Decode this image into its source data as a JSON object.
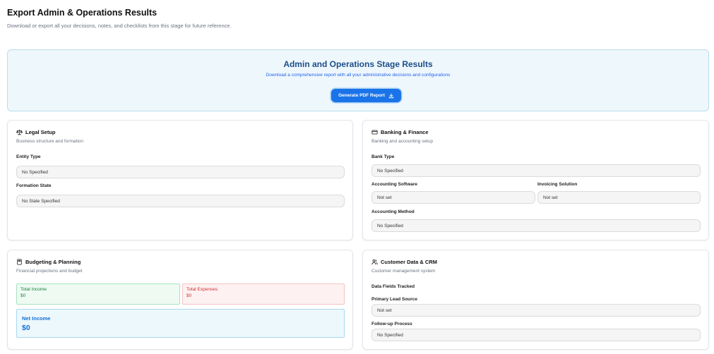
{
  "header": {
    "title": "Export Admin & Operations Results",
    "subtitle": "Download or export all your decisions, notes, and checklists from this stage for future reference."
  },
  "hero": {
    "title": "Admin and Operations Stage Results",
    "description": "Download a comprehensive report with all your administrative decisions and configurations",
    "button_label": "Generate PDF Report",
    "button_icon": "download-icon"
  },
  "legal": {
    "icon": "scale-icon",
    "title": "Legal Setup",
    "subtitle": "Business structure and formation",
    "entity_type_label": "Entity Type",
    "entity_type_value": "No Specified",
    "formation_state_label": "Formation State",
    "formation_state_value": "No State Specified"
  },
  "banking": {
    "icon": "credit-card-icon",
    "title": "Banking & Finance",
    "subtitle": "Banking and accounting setup",
    "bank_type_label": "Bank Type",
    "bank_type_value": "No Specified",
    "accounting_software_label": "Accounting Software",
    "accounting_software_value": "Not set",
    "invoicing_label": "Invoicing Solution",
    "invoicing_value": "Not set",
    "accounting_method_label": "Accounting Method",
    "accounting_method_value": "No Specified"
  },
  "budgeting": {
    "icon": "calculator-icon",
    "title": "Budgeting & Planning",
    "subtitle": "Financial projections and budget",
    "income_label": "Total Income",
    "income_value": "$0",
    "expenses_label": "Total Expenses",
    "expenses_value": "$0",
    "net_label": "Net Income",
    "net_value": "$0"
  },
  "crm": {
    "icon": "users-icon",
    "title": "Customer Data & CRM",
    "subtitle": "Customer management system",
    "data_fields_label": "Data Fields Tracked",
    "lead_source_label": "Primary Lead Source",
    "lead_source_value": "Not set",
    "followup_label": "Follow-up Process",
    "followup_value": "No Specified"
  },
  "colors": {
    "primary": "#1a73e8",
    "hero_bg": "#eef7fc",
    "income": "#16803c",
    "expense": "#d03030",
    "net": "#1570d6"
  }
}
